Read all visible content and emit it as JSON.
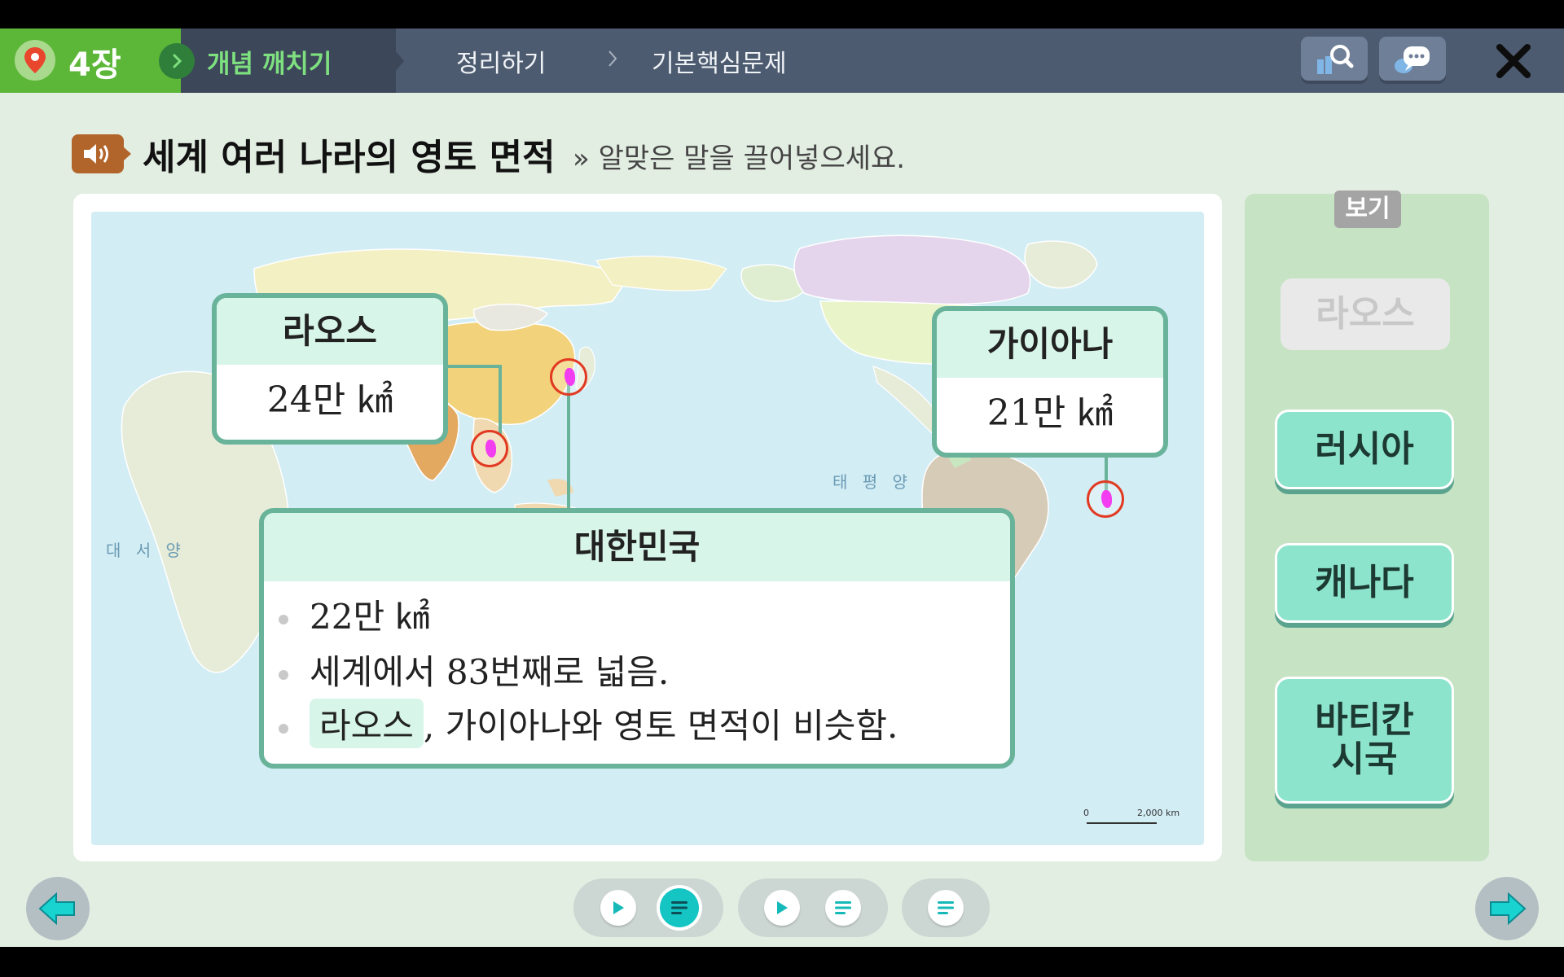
{
  "topbar": {
    "chapter": "4장",
    "tabs": [
      {
        "label": "개념 깨치기",
        "active": true
      },
      {
        "label": "정리하기",
        "active": false
      },
      {
        "label": "기본핵심문제",
        "active": false
      }
    ],
    "accent": "#5cb738"
  },
  "header": {
    "title": "세계 여러 나라의 영토 면적",
    "instruction": "» 알맞은 말을 끌어넣으세요."
  },
  "map": {
    "ocean_atlantic": "대 서 양",
    "ocean_pacific": "태 평 양",
    "scale": {
      "start": "0",
      "end": "2,000 km"
    },
    "callouts": {
      "laos": {
        "name": "라오스",
        "area": "24만 ㎢"
      },
      "guyana": {
        "name": "가이아나",
        "area": "21만 ㎢"
      },
      "korea": {
        "name": "대한민국",
        "line1": "22만 ㎢",
        "line2": "세계에서 83번째로 넓음.",
        "line3_answer": "라오스",
        "line3_rest": ", 가이아나와 영토 면적이 비슷함."
      }
    }
  },
  "options": {
    "tag": "보기",
    "items": [
      {
        "label": "라오스",
        "used": true
      },
      {
        "label": "러시아",
        "used": false
      },
      {
        "label": "캐나다",
        "used": false
      },
      {
        "label": "바티칸\n시국",
        "used": false
      }
    ],
    "item_color": "#8de4cd"
  }
}
